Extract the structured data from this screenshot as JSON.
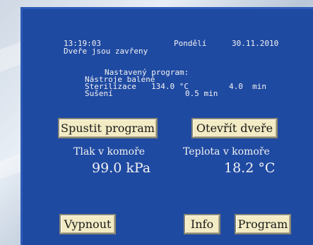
{
  "header": {
    "time": "13:19:03",
    "day": "Pondělí",
    "date": "30.11.2010",
    "door_status": "Dveře jsou zavřeny"
  },
  "program": {
    "title": "Nastavený program:",
    "name": "Nástroje balené",
    "sterilization_label": "Sterilizace",
    "sterilization_temp": "134.0 °C",
    "sterilization_time": "4.0  min",
    "drying_label": "Sušení",
    "drying_time": "0.5 min"
  },
  "buttons": {
    "start": "Spustit program",
    "open_door": "Otevřít dveře",
    "off": "Vypnout",
    "info": "Info",
    "program": "Program"
  },
  "readings": {
    "pressure_label": "Tlak v komoře",
    "pressure_value": "99.0 kPa",
    "temperature_label": "Teplota v komoře",
    "temperature_value": "18.2 °C"
  }
}
